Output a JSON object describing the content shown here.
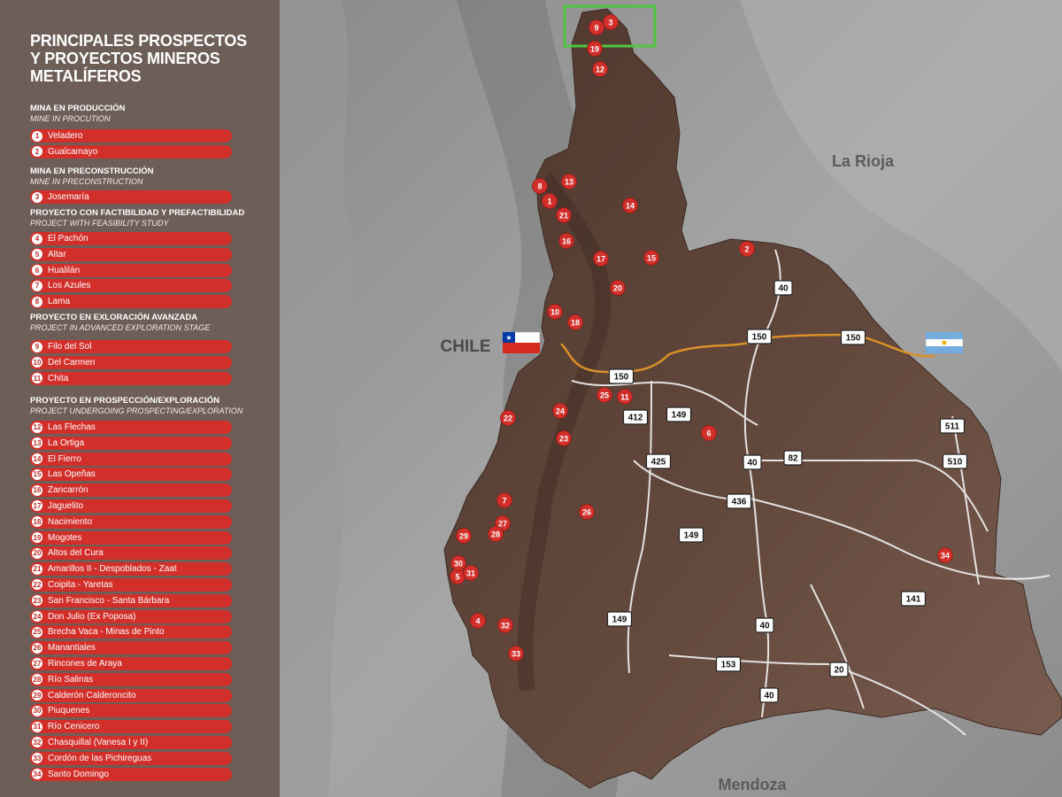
{
  "title_lines": [
    "PRINCIPALES PROSPECTOS",
    "Y PROYECTOS MINEROS",
    "METALÍFEROS"
  ],
  "sections": [
    {
      "title": "MINA EN PRODUCCIÓN",
      "subtitle": "MINE IN PROCUTION",
      "items": [
        {
          "n": "1",
          "label": "Veladero"
        },
        {
          "n": "2",
          "label": "Gualcamayo"
        }
      ]
    },
    {
      "title": "MINA EN PRECONSTRUCCIÓN",
      "subtitle": "MINE IN PRECONSTRUCTION",
      "items": [
        {
          "n": "3",
          "label": "Josemaría"
        }
      ]
    },
    {
      "title": "PROYECTO CON FACTIBILIDAD Y PREFACTIBILIDAD",
      "subtitle": "PROJECT WITH FEASIBILITY STUDY",
      "items": [
        {
          "n": "4",
          "label": "El Pachón"
        },
        {
          "n": "5",
          "label": "Altar"
        },
        {
          "n": "6",
          "label": "Hualilán"
        },
        {
          "n": "7",
          "label": "Los Azules"
        },
        {
          "n": "8",
          "label": "Lama"
        }
      ]
    },
    {
      "title": "PROYECTO EN EXLORACIÓN AVANZADA",
      "subtitle": "PROJECT IN ADVANCED EXPLORATION STAGE",
      "items": [
        {
          "n": "9",
          "label": "Filo del Sol"
        },
        {
          "n": "10",
          "label": "Del Carmen"
        },
        {
          "n": "11",
          "label": "Chita"
        }
      ]
    },
    {
      "title": "PROYECTO EN PROSPECCIÓN/EXPLORACIÓN",
      "subtitle": "PROJECT UNDERGOING PROSPECTING/EXPLORATION",
      "items": [
        {
          "n": "12",
          "label": "Las Flechas"
        },
        {
          "n": "13",
          "label": "La Ortiga"
        },
        {
          "n": "14",
          "label": "El Fierro"
        },
        {
          "n": "15",
          "label": "Las Opeñas"
        },
        {
          "n": "16",
          "label": "Zancarrón"
        },
        {
          "n": "17",
          "label": "Jaguelito"
        },
        {
          "n": "18",
          "label": "Nacimiento"
        },
        {
          "n": "19",
          "label": "Mogotes"
        },
        {
          "n": "20",
          "label": "Altos del Cura"
        },
        {
          "n": "21",
          "label": "Amarillos II - Despoblados - Zaat"
        },
        {
          "n": "22",
          "label": "Coipita - Yaretas"
        },
        {
          "n": "23",
          "label": "San Francisco - Santa Bárbara"
        },
        {
          "n": "24",
          "label": "Don Julio (Ex Poposa)"
        },
        {
          "n": "25",
          "label": "Brecha Vaca - Minas de Pinto"
        },
        {
          "n": "26",
          "label": "Manantiales"
        },
        {
          "n": "27",
          "label": "Rincones de Araya"
        },
        {
          "n": "28",
          "label": "Río Salinas"
        },
        {
          "n": "29",
          "label": "Calderón Calderoncito"
        },
        {
          "n": "30",
          "label": "Piuquenes"
        },
        {
          "n": "31",
          "label": "Río Cenicero"
        },
        {
          "n": "32",
          "label": "Chasquillal (Vanesa I y II)"
        },
        {
          "n": "33",
          "label": "Cordón de las Pichireguas"
        },
        {
          "n": "34",
          "label": "Santo Domingo"
        }
      ]
    }
  ],
  "map": {
    "labels": {
      "la_rioja": "La Rioja",
      "chile": "CHILE",
      "mendoza": "Mendoza"
    },
    "routes": [
      "150",
      "150",
      "150",
      "40",
      "40",
      "40",
      "40",
      "412",
      "149",
      "149",
      "149",
      "425",
      "436",
      "82",
      "511",
      "510",
      "141",
      "153",
      "20"
    ],
    "pins": [
      "1",
      "2",
      "3",
      "4",
      "5",
      "6",
      "7",
      "8",
      "9",
      "10",
      "11",
      "12",
      "13",
      "14",
      "15",
      "16",
      "17",
      "18",
      "19",
      "20",
      "21",
      "22",
      "23",
      "24",
      "25",
      "26",
      "27",
      "28",
      "29",
      "30",
      "31",
      "32",
      "33",
      "34"
    ],
    "flags": [
      "chile-flag",
      "argentina-flag"
    ]
  },
  "colors": {
    "sidebar": "#6e5e58",
    "pin": "#d32f2a",
    "province": "#5d4438",
    "route_international": "#d9902a",
    "highlight": "#4cc73d"
  }
}
